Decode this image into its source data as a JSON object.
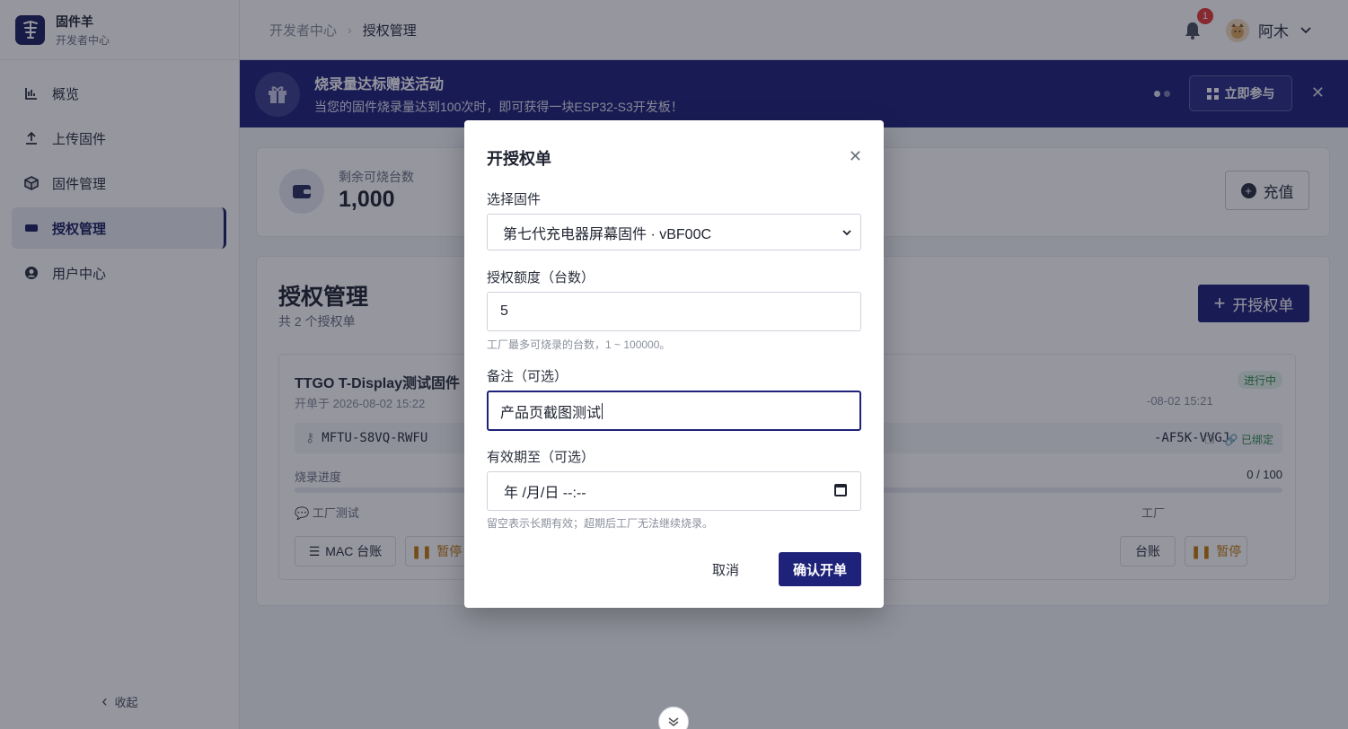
{
  "brand": {
    "name": "固件羊",
    "subtitle": "开发者中心"
  },
  "sidebar": {
    "items": [
      {
        "label": "概览",
        "icon": "chart-bars-icon",
        "active": false
      },
      {
        "label": "上传固件",
        "icon": "upload-icon",
        "active": false
      },
      {
        "label": "固件管理",
        "icon": "package-icon",
        "active": false
      },
      {
        "label": "授权管理",
        "icon": "ticket-icon",
        "active": true
      },
      {
        "label": "用户中心",
        "icon": "user-circle-icon",
        "active": false
      }
    ],
    "collapse_label": "收起"
  },
  "header": {
    "breadcrumb": [
      "开发者中心",
      "授权管理"
    ],
    "notification_count": "1",
    "username": "阿木"
  },
  "banner": {
    "title": "烧录量达标赠送活动",
    "description": "当您的固件烧录量达到100次时，即可获得一块ESP32-S3开发板！",
    "cta_label": "立即参与"
  },
  "stats": {
    "label": "剩余可烧台数",
    "value": "1,000",
    "recharge_label": "充值"
  },
  "licenses": {
    "title": "授权管理",
    "count_text": "共 2 个授权单",
    "new_label": "开授权单",
    "cards": [
      {
        "name": "TTGO T-Display测试固件",
        "created": "开单于 2026-08-02 15:22",
        "code": "MFTU-S8VQ-RWFU",
        "progress_label": "烧录进度",
        "note": "工厂测试",
        "mac_label": "MAC 台账",
        "pause_label": "暂停"
      },
      {
        "created_partial": "-08-02 15:21",
        "code_partial": "-AF5K-VVGJ",
        "status": "进行中",
        "bound_label": "已绑定",
        "progress": "0 / 100",
        "note_partial": "工厂",
        "mac_partial": "台账",
        "pause_label": "暂停"
      }
    ]
  },
  "modal": {
    "title": "开授权单",
    "firmware_label": "选择固件",
    "firmware_value": "第七代充电器屏幕固件 · vBF00C",
    "quota_label": "授权额度（台数）",
    "quota_value": "5",
    "quota_hint": "工厂最多可烧录的台数，1 ~ 100000。",
    "note_label": "备注（可选）",
    "note_value": "产品页截图测试",
    "expiry_label": "有效期至（可选）",
    "expiry_placeholder": "年 /月/日 --:--",
    "expiry_hint": "留空表示长期有效；超期后工厂无法继续烧录。",
    "cancel_label": "取消",
    "confirm_label": "确认开单"
  },
  "colors": {
    "primary": "#1e2278",
    "success": "#2e8a4c",
    "warning": "#c47a0c",
    "danger": "#e53935"
  }
}
